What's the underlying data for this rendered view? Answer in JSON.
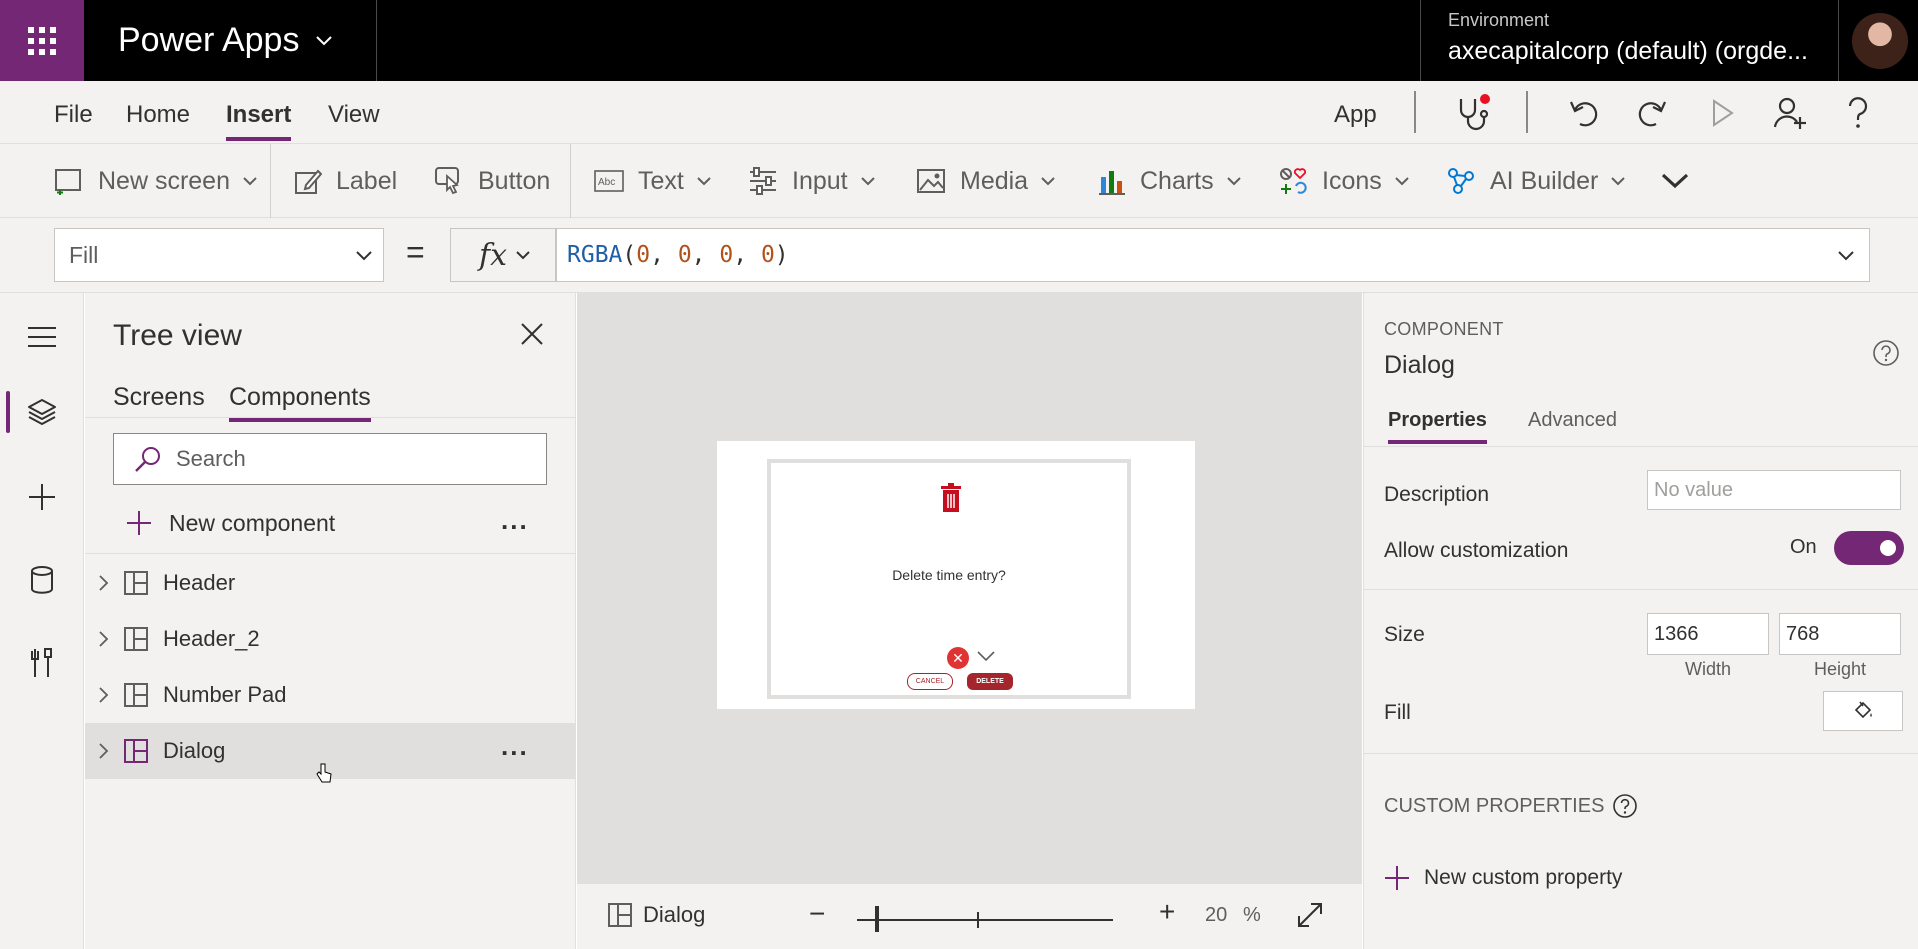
{
  "topbar": {
    "app_name": "Power Apps",
    "environment_label": "Environment",
    "environment_name": "axecapitalcorp (default) (orgde..."
  },
  "menu": {
    "items": [
      "File",
      "Home",
      "Insert",
      "View"
    ],
    "active": "Insert",
    "app_label": "App"
  },
  "ribbon": {
    "new_screen": "New screen",
    "label": "Label",
    "button": "Button",
    "text": "Text",
    "input": "Input",
    "media": "Media",
    "charts": "Charts",
    "icons": "Icons",
    "ai_builder": "AI Builder"
  },
  "formula_bar": {
    "property": "Fill",
    "equals": "=",
    "fx": "fx",
    "fn": "RGBA",
    "open": "(",
    "args": [
      "0",
      "0",
      "0",
      "0"
    ],
    "sep": ", ",
    "close": ")"
  },
  "tree": {
    "title": "Tree view",
    "tabs": [
      "Screens",
      "Components"
    ],
    "active_tab": "Components",
    "search_placeholder": "Search",
    "new_component": "New component",
    "more": "...",
    "items": [
      {
        "label": "Header"
      },
      {
        "label": "Header_2"
      },
      {
        "label": "Number Pad"
      },
      {
        "label": "Dialog"
      }
    ],
    "selected": "Dialog"
  },
  "canvas": {
    "dialog_text": "Delete time entry?",
    "cancel_label": "CANCEL",
    "delete_label": "DELETE",
    "x_glyph": "✕"
  },
  "statusbar": {
    "component_name": "Dialog",
    "zoom_minus": "−",
    "zoom_plus": "+",
    "zoom_value": "20",
    "zoom_unit": "%",
    "zoom_level": 0.2
  },
  "properties": {
    "kicker": "COMPONENT",
    "name": "Dialog",
    "tabs": [
      "Properties",
      "Advanced"
    ],
    "active_tab": "Properties",
    "description_label": "Description",
    "description_placeholder": "No value",
    "allow_customization_label": "Allow customization",
    "allow_customization_value": "On",
    "size_label": "Size",
    "width": "1366",
    "height": "768",
    "width_label": "Width",
    "height_label": "Height",
    "fill_label": "Fill",
    "custom_properties_title": "CUSTOM PROPERTIES",
    "new_custom_property": "New custom property"
  },
  "colors": {
    "brand": "#742774",
    "topbar": "#000000",
    "danger": "#A4262C",
    "notification_dot": "#E81123"
  },
  "icons": [
    "waffle-icon",
    "chevron-down-icon",
    "stethoscope-icon",
    "undo-icon",
    "redo-icon",
    "play-icon",
    "add-user-icon",
    "help-icon",
    "hamburger-icon",
    "layers-icon",
    "plus-icon",
    "database-icon",
    "tools-icon",
    "close-icon",
    "search-icon",
    "component-icon",
    "trash-icon",
    "fit-to-screen-icon"
  ]
}
